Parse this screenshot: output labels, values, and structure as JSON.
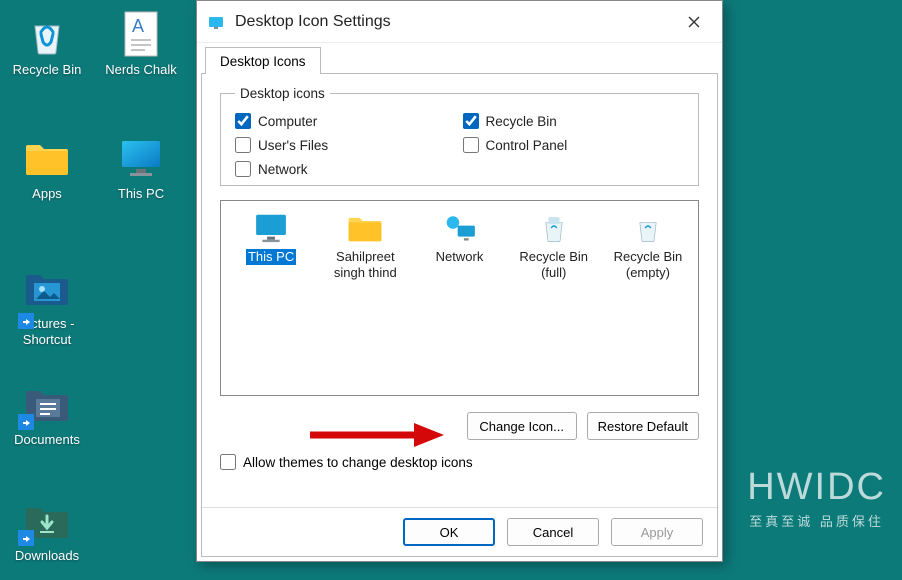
{
  "desktop": {
    "recycle_bin": "Recycle Bin",
    "nerds_chalk": "Nerds Chalk",
    "apps": "Apps",
    "this_pc": "This PC",
    "pictures_shortcut": "Pictures - Shortcut",
    "documents": "Documents",
    "downloads": "Downloads"
  },
  "dialog": {
    "title": "Desktop Icon Settings",
    "tab": "Desktop Icons",
    "fieldset_legend": "Desktop icons",
    "checks": {
      "computer": "Computer",
      "recycle_bin": "Recycle Bin",
      "users_files": "User's Files",
      "control_panel": "Control Panel",
      "network": "Network"
    },
    "preview": {
      "this_pc": "This PC",
      "user": "Sahilpreet singh thind",
      "network": "Network",
      "recycle_full": "Recycle Bin (full)",
      "recycle_empty": "Recycle Bin (empty)"
    },
    "change_icon": "Change Icon...",
    "restore_default": "Restore Default",
    "allow_themes": "Allow themes to change desktop icons",
    "ok": "OK",
    "cancel": "Cancel",
    "apply": "Apply"
  },
  "watermark": {
    "big": "HWIDC",
    "small": "至真至诚 品质保住"
  }
}
